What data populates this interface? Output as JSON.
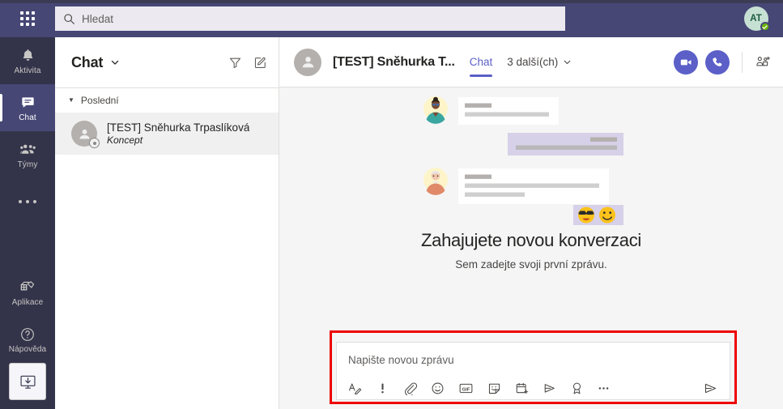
{
  "topbar": {
    "waffle_label": "app-launcher",
    "search": {
      "placeholder": "Hledat",
      "value": "",
      "icon": "search-icon"
    },
    "avatar": {
      "initials": "AT",
      "presence": "available"
    }
  },
  "rail": {
    "items": [
      {
        "label": "Aktivita",
        "icon": "bell-icon",
        "active": false
      },
      {
        "label": "Chat",
        "icon": "chat-icon",
        "active": true
      },
      {
        "label": "Týmy",
        "icon": "teams-icon",
        "active": false
      },
      {
        "label": "",
        "icon": "more-icon",
        "active": false
      },
      {
        "label": "Aplikace",
        "icon": "apps-icon",
        "active": false
      },
      {
        "label": "Nápověda",
        "icon": "help-icon",
        "active": false
      }
    ],
    "download_button": {
      "label": "download-desktop-app",
      "icon": "download-monitor-icon"
    }
  },
  "chatlist": {
    "title": "Chat",
    "dropdown_icon": "chevron-down-icon",
    "filter_icon": "filter-icon",
    "compose_icon": "new-chat-icon",
    "group_label": "Poslední",
    "items": [
      {
        "name": "[TEST] Sněhurka Trpaslíková",
        "subtitle": "Koncept",
        "selected": true
      }
    ]
  },
  "main": {
    "header": {
      "title": "[TEST] Sněhurka T...",
      "tabs": [
        {
          "label": "Chat",
          "active": true
        },
        {
          "label": "3 další(ch)",
          "active": false,
          "icon": "chevron-down-icon"
        }
      ],
      "video_button": "video-call-icon",
      "audio_button": "audio-call-icon",
      "add_people_button": "add-people-icon"
    },
    "empty_state": {
      "title": "Zahajujete novou konverzaci",
      "subtitle": "Sem zadejte svoji první zprávu.",
      "illustration": "new-conversation-illustration",
      "emoji": [
        "😎",
        "🙂"
      ]
    },
    "compose": {
      "placeholder": "Napište novou zprávu",
      "value": "",
      "highlight_color": "#ee0000",
      "tools": [
        {
          "name": "format-icon",
          "glyph": "format"
        },
        {
          "name": "importance-icon",
          "glyph": "importance"
        },
        {
          "name": "attach-icon",
          "glyph": "attach"
        },
        {
          "name": "emoji-icon",
          "glyph": "emoji"
        },
        {
          "name": "giphy-icon",
          "glyph": "gif"
        },
        {
          "name": "sticker-icon",
          "glyph": "sticker"
        },
        {
          "name": "meeting-icon",
          "glyph": "meeting"
        },
        {
          "name": "stream-icon",
          "glyph": "stream"
        },
        {
          "name": "praise-icon",
          "glyph": "praise"
        },
        {
          "name": "more-options-icon",
          "glyph": "more"
        }
      ],
      "send_icon": "send-icon"
    }
  },
  "colors": {
    "brand_purple": "#464775",
    "accent_purple": "#5b5fc7",
    "rail_dark": "#33344a",
    "highlight_red": "#ee0000",
    "canvas": "#f5f5f5"
  }
}
